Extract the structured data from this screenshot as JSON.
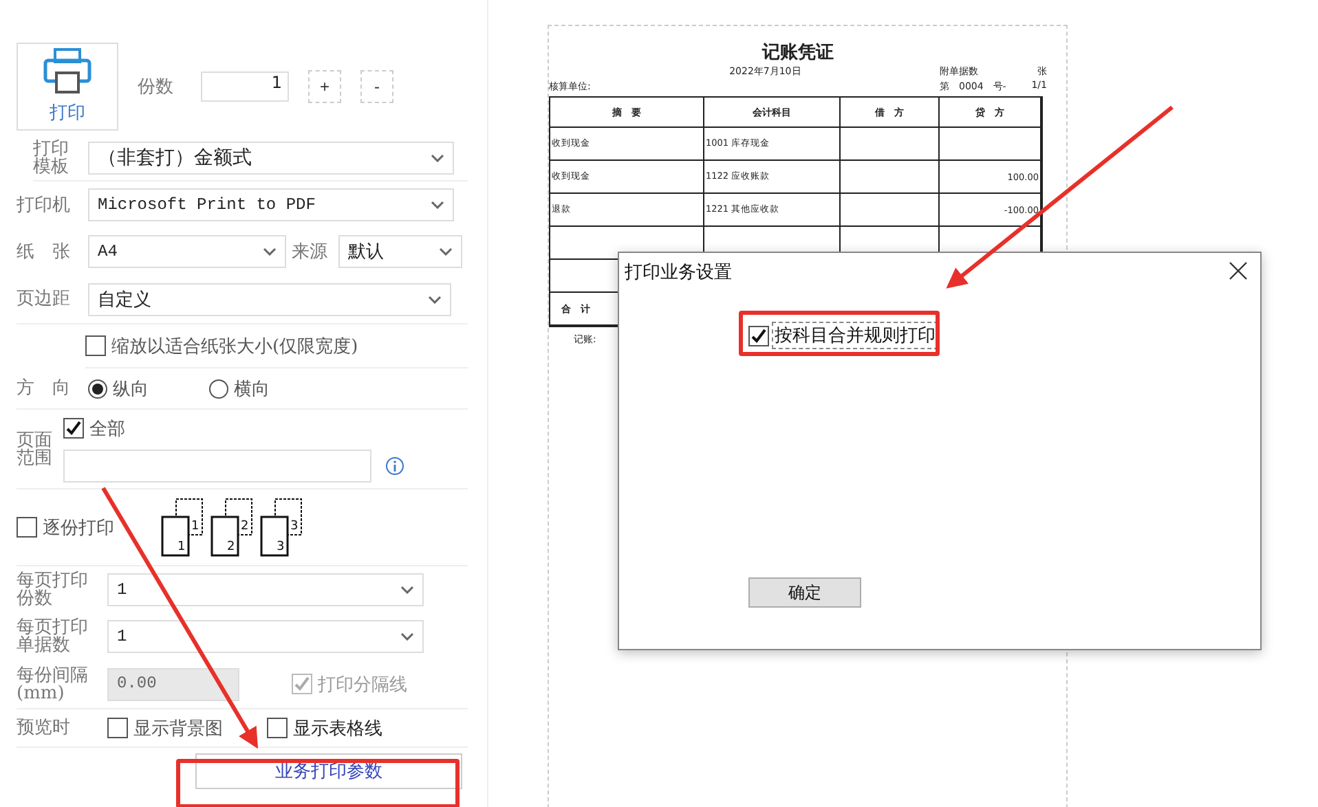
{
  "print_panel": {
    "print_button": "打印",
    "copies": {
      "label": "份数",
      "value": "1",
      "increment": "+",
      "decrement": "-"
    },
    "template": {
      "label": "打印模板",
      "value": "（非套打）金额式"
    },
    "printer": {
      "label": "打印机",
      "value": "Microsoft Print to PDF"
    },
    "paper": {
      "label": "纸　张",
      "value": "A4"
    },
    "source": {
      "label": "来源",
      "value": "默认"
    },
    "margin": {
      "label": "页边距",
      "value": "自定义"
    },
    "fit_to_width": {
      "label": "缩放以适合纸张大小(仅限宽度)",
      "checked": false
    },
    "orientation": {
      "label": "方　向",
      "options": [
        {
          "label": "纵向",
          "selected": true
        },
        {
          "label": "横向",
          "selected": false
        }
      ]
    },
    "page_range": {
      "label": "页面范围",
      "all": {
        "label": "全部",
        "checked": true
      }
    },
    "collate": {
      "label": "逐份打印",
      "checked": false,
      "pages": [
        {
          "back": "1",
          "front": "1"
        },
        {
          "back": "2",
          "front": "2"
        },
        {
          "back": "3",
          "front": "3"
        }
      ]
    },
    "copies_per_page": {
      "label": "每页打印份数",
      "value": "1"
    },
    "vouchers_per_page": {
      "label": "每页打印单据数",
      "value": "1"
    },
    "gap": {
      "label": "每份间隔(mm)",
      "value": "0.00",
      "disabled": true
    },
    "separator": {
      "label": "打印分隔线",
      "checked": true,
      "disabled": true
    },
    "preview": {
      "label": "预览时",
      "options": [
        {
          "label": "显示背景图",
          "checked": false
        },
        {
          "label": "显示表格线",
          "checked": false
        }
      ]
    },
    "business_params_button": "业务打印参数"
  },
  "voucher": {
    "title": "记账凭证",
    "date": "2022年7月10日",
    "attach_label": "附单据数",
    "attach_unit": "张",
    "number": "第　0004　号-",
    "page": "1/1",
    "unit_label": "核算单位:",
    "columns": [
      "摘　要",
      "会计科目",
      "借　方",
      "贷　方"
    ],
    "rows": [
      [
        "收到现金",
        "1001 库存现金",
        "",
        ""
      ],
      [
        "收到现金",
        "1122 应收账款",
        "",
        "100.00"
      ],
      [
        "退款",
        "1221 其他应收款",
        "",
        "-100.00"
      ]
    ],
    "total_label": "合　计",
    "bookkeeper": "记账:"
  },
  "dialog": {
    "title": "打印业务设置",
    "merge": {
      "label": "按科目合并规则打印",
      "checked": true
    },
    "ok": "确定"
  }
}
